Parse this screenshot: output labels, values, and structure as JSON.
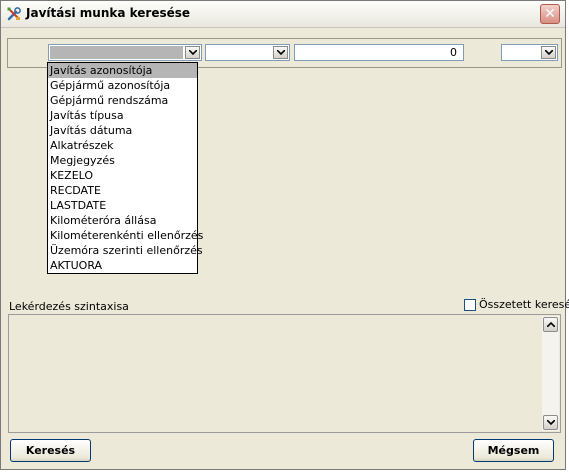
{
  "window": {
    "title": "Javítási munka keresése",
    "icons": {
      "app": "tools-icon",
      "close": "close-icon"
    }
  },
  "filter": {
    "field_combo_value": "",
    "operator_combo_value": "",
    "value_input": "0",
    "logic_combo_value": ""
  },
  "dropdown": {
    "items": [
      "Javítás azonosítója",
      "Gépjármű azonosítója",
      "Gépjármű rendszáma",
      "Javítás típusa",
      "Javítás dátuma",
      "Alkatrészek",
      "Megjegyzés",
      "KEZELO",
      "RECDATE",
      "LASTDATE",
      "Kilométeróra állása",
      "Kilométerenkénti ellenőrzés",
      "Üzemóra szerinti ellenőrzés",
      "AKTUORA"
    ],
    "highlighted_item": "Javítás azonosítója"
  },
  "query": {
    "syntax_label": "Lekérdezés szintaxisa",
    "complex_search_label": "Összetett keresés",
    "complex_search_checked": false,
    "syntax_text": ""
  },
  "buttons": {
    "search_label": "Keresés",
    "cancel_label": "Mégsem"
  },
  "colors": {
    "window_bg": "#ece9d8",
    "close_button": "#d88f83",
    "selection": "#b5b5b5",
    "input_border": "#7f9db9",
    "button_border": "#003c74"
  }
}
